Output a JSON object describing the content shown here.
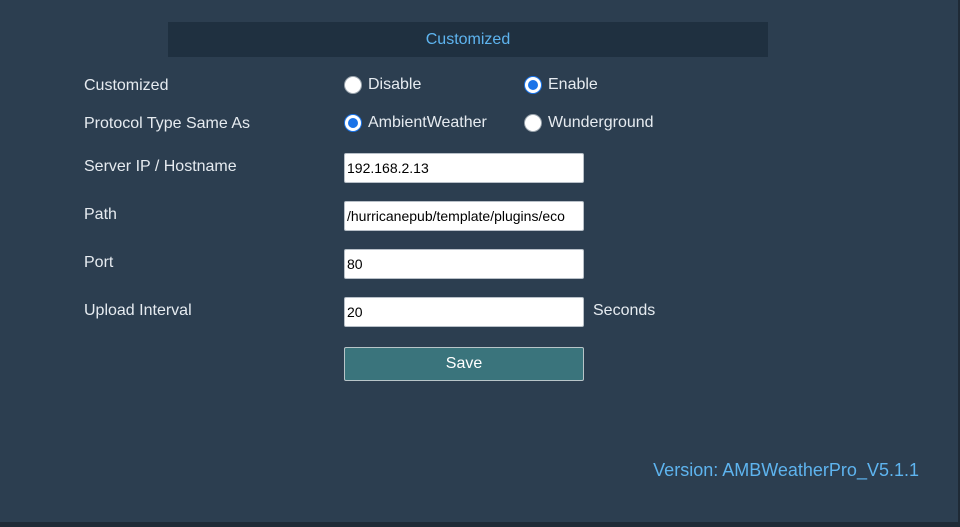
{
  "section": {
    "title": "Customized"
  },
  "customized": {
    "label": "Customized",
    "options": [
      {
        "label": "Disable",
        "checked": false
      },
      {
        "label": "Enable",
        "checked": true
      }
    ]
  },
  "protocol": {
    "label": "Protocol Type Same As",
    "options": [
      {
        "label": "AmbientWeather",
        "checked": true
      },
      {
        "label": "Wunderground",
        "checked": false
      }
    ]
  },
  "server": {
    "label": "Server IP / Hostname",
    "value": "192.168.2.13"
  },
  "path": {
    "label": "Path",
    "value": "/hurricanepub/template/plugins/eco"
  },
  "port": {
    "label": "Port",
    "value": "80"
  },
  "interval": {
    "label": "Upload Interval",
    "value": "20",
    "unit": "Seconds"
  },
  "actions": {
    "save_label": "Save"
  },
  "footer": {
    "version": "Version: AMBWeatherPro_V5.1.1"
  },
  "colors": {
    "background": "#2c3e50",
    "header_bg": "#1f3040",
    "accent": "#5eb4ef",
    "button_bg": "#3a747c",
    "radio_checked": "#1a73e8"
  }
}
